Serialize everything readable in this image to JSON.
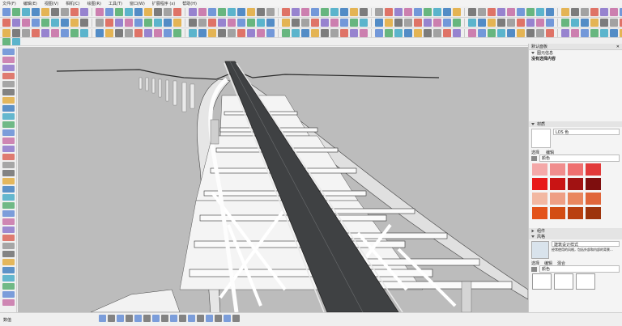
{
  "menu": [
    "文件(F)",
    "编辑(E)",
    "视图(V)",
    "相机(C)",
    "绘图(R)",
    "工具(T)",
    "窗口(W)",
    "扩展程序 (x)",
    "帮助(H)"
  ],
  "panel": {
    "tray_title": "默认面板",
    "entity_info_title": "图元信息",
    "no_selection": "没有选择内容",
    "materials_title": "材质",
    "material_name": "LOS 色",
    "tab_select": "选择",
    "tab_edit": "编辑",
    "category": "颜色",
    "swatches": [
      "#f4a8a8",
      "#f08d8d",
      "#ef7070",
      "#e23a3a",
      "#e81919",
      "#c91414",
      "#a11212",
      "#7e0e0e",
      "#f2b8a2",
      "#ee9f85",
      "#e9875f",
      "#e0663a",
      "#e3531a",
      "#d34d14",
      "#b94010",
      "#9d340c"
    ],
    "components_title": "组件",
    "styles_title": "风格",
    "style_name": "建筑设计样式",
    "style_desc": "经常使用的风格，包括外部和内部的背景...",
    "style_tabs": [
      "选择",
      "编辑",
      "混合"
    ],
    "style_category": "颜色"
  },
  "status": {
    "label": "数值"
  },
  "colors": {
    "sky": "#bcbcbc",
    "ground": "#b6b6b6",
    "road": "#3f4143",
    "deck": "#f3f3f3"
  }
}
